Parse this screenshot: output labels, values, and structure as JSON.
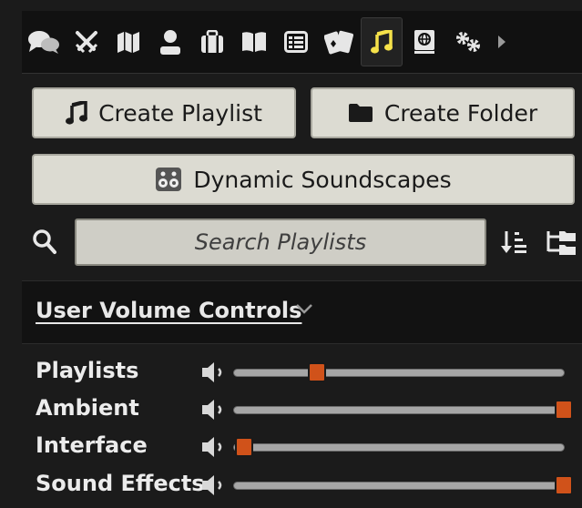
{
  "tabs": [
    {
      "icon": "chat-bubbles-icon",
      "active": false
    },
    {
      "icon": "crossed-swords-icon",
      "active": false
    },
    {
      "icon": "map-icon",
      "active": false
    },
    {
      "icon": "user-icon",
      "active": false
    },
    {
      "icon": "suitcase-icon",
      "active": false
    },
    {
      "icon": "open-book-icon",
      "active": false
    },
    {
      "icon": "table-list-icon",
      "active": false
    },
    {
      "icon": "playing-cards-icon",
      "active": false
    },
    {
      "icon": "music-note-icon",
      "active": true
    },
    {
      "icon": "compendium-globe-icon",
      "active": false
    },
    {
      "icon": "gears-icon",
      "active": false
    },
    {
      "icon": "caret-right-icon",
      "active": false
    }
  ],
  "buttons": {
    "create_playlist": "Create Playlist",
    "create_folder": "Create Folder",
    "dynamic_soundscapes": "Dynamic Soundscapes"
  },
  "search": {
    "placeholder": "Search Playlists"
  },
  "volume": {
    "title": "User Volume Controls",
    "controls": [
      {
        "label": "Playlists",
        "level": 0.25
      },
      {
        "label": "Ambient",
        "level": 1.0
      },
      {
        "label": "Interface",
        "level": 0.03
      },
      {
        "label": "Sound Effects",
        "level": 1.0
      }
    ]
  },
  "colors": {
    "accent_active_icon": "#f5e14a",
    "slider_thumb": "#d0521a",
    "button_bg": "#dcdbd2"
  }
}
